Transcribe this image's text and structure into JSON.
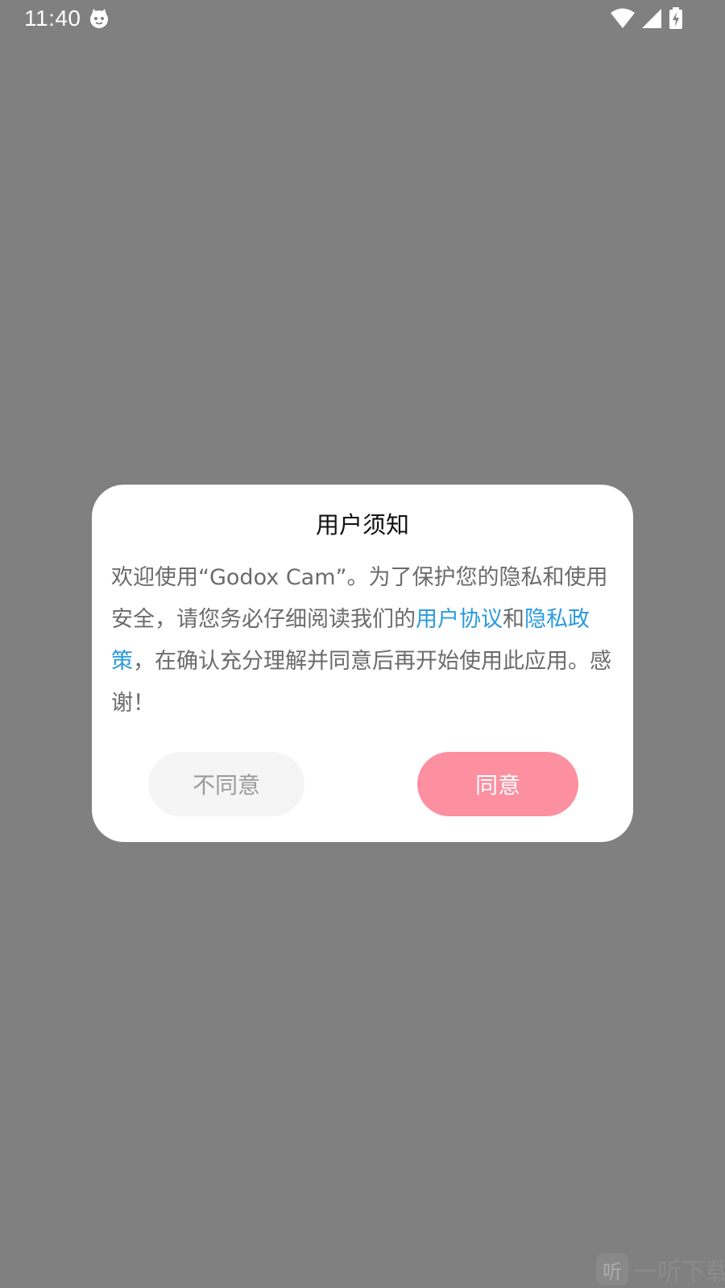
{
  "status_bar": {
    "time": "11:40",
    "app_icon": "cat-face-icon",
    "wifi_icon": "wifi-icon",
    "signal_icon": "cell-signal-icon",
    "battery_icon": "battery-charging-icon"
  },
  "dialog": {
    "title": "用户须知",
    "body_text_1": "欢迎使用“Godox Cam”。为了保护您的隐私和使用安全，请您务必仔细阅读我们的",
    "user_agreement_link": "用户协议",
    "connector_text": "和",
    "privacy_policy_link": "隐私政策",
    "body_text_2": "，在确认充分理解并同意后再开始使用此应用。感谢！",
    "disagree_label": "不同意",
    "agree_label": "同意"
  },
  "watermark": {
    "logo_char": "听",
    "text": "一听下载"
  },
  "colors": {
    "overlay": "#808080",
    "dialog_bg": "#ffffff",
    "link": "#2b9be0",
    "agree_button": "#fc8fa0",
    "disagree_button": "#f5f5f5"
  }
}
